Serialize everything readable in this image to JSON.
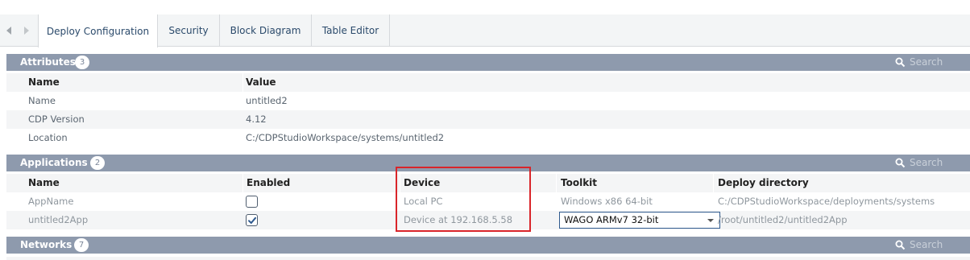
{
  "tabs": {
    "items": [
      {
        "label": "Deploy Configuration",
        "active": true
      },
      {
        "label": "Security"
      },
      {
        "label": "Block Diagram"
      },
      {
        "label": "Table Editor"
      }
    ]
  },
  "attributes": {
    "title": "Attributes",
    "count": "3",
    "search_placeholder": "Search",
    "columns": [
      "Name",
      "Value"
    ],
    "rows": [
      {
        "name": "Name",
        "value": "untitled2"
      },
      {
        "name": "CDP Version",
        "value": "4.12"
      },
      {
        "name": "Location",
        "value": "C:/CDPStudioWorkspace/systems/untitled2"
      }
    ]
  },
  "applications": {
    "title": "Applications",
    "count": "2",
    "search_placeholder": "Search",
    "columns": [
      "Name",
      "Enabled",
      "Device",
      "Toolkit",
      "Deploy directory"
    ],
    "rows": [
      {
        "name": "AppName",
        "enabled": false,
        "device": "Local PC",
        "toolkit": "Windows x86 64-bit",
        "deploy_dir": "C:/CDPStudioWorkspace/deployments/systems..."
      },
      {
        "name": "untitled2App",
        "enabled": true,
        "device": "Device at 192.168.5.58",
        "toolkit": "WAGO ARMv7 32-bit",
        "deploy_dir": "/root/untitled2/untitled2App"
      }
    ]
  },
  "networks": {
    "title": "Networks",
    "count": "7",
    "search_placeholder": "Search"
  },
  "colors": {
    "section_header": "#8e9aad",
    "highlight": "#d9252a",
    "select_border": "#2f5a8e"
  }
}
